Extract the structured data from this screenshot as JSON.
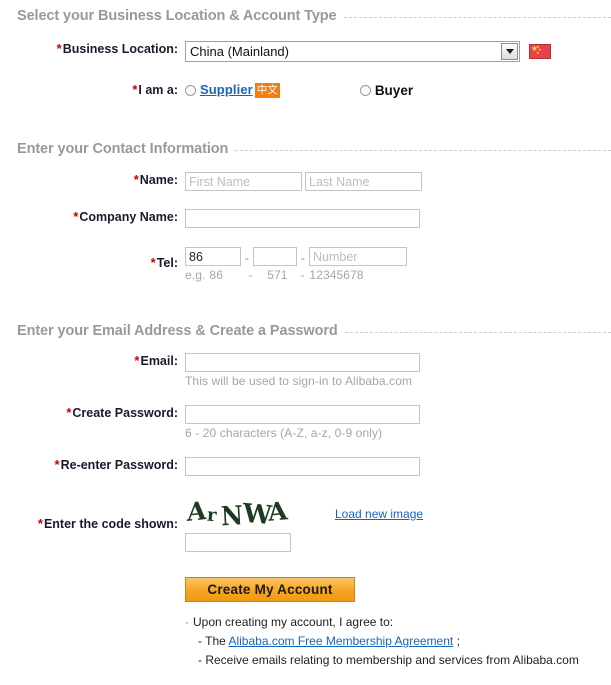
{
  "sections": {
    "location": {
      "title": "Select your Business Location & Account Type"
    },
    "contact": {
      "title": "Enter your Contact Information"
    },
    "account": {
      "title": "Enter your Email Address & Create a Password"
    }
  },
  "required_marker": "*",
  "business_location": {
    "label": "Business Location:",
    "selected": "China (Mainland)",
    "options": [
      "China (Mainland)"
    ],
    "flag_name": "china-flag-icon",
    "flag_color": "#e8424a",
    "star_color": "#ffdd55"
  },
  "role": {
    "label": "I am a:",
    "supplier_label": "Supplier",
    "supplier_badge": "中文",
    "badge_color": "#f57c12",
    "buyer_label": "Buyer",
    "selected": "none"
  },
  "name": {
    "label": "Name:",
    "first_value": "",
    "first_placeholder": "First Name",
    "last_value": "",
    "last_placeholder": "Last Name"
  },
  "company": {
    "label": "Company Name:",
    "value": "",
    "placeholder": ""
  },
  "tel": {
    "label": "Tel:",
    "country_value": "86",
    "area_value": "",
    "number_value": "",
    "number_placeholder": "Number",
    "separator": "-",
    "hint_prefix": "e.g.",
    "hint_country": "86",
    "hint_area": "571",
    "hint_number": "12345678"
  },
  "email": {
    "label": "Email:",
    "value": "",
    "placeholder": "",
    "hint": "This will be used to sign-in to Alibaba.com"
  },
  "password": {
    "label": "Create Password:",
    "value": "",
    "hint": "6 - 20 characters (A-Z, a-z, 0-9 only)"
  },
  "password_confirm": {
    "label": "Re-enter Password:",
    "value": ""
  },
  "captcha": {
    "label": "Enter the code shown:",
    "code_text": "ArNWA",
    "code_chars": [
      "A",
      "r",
      "N",
      "W",
      "A"
    ],
    "code_color": "#1d3b22",
    "reload_link": "Load new image",
    "input_value": "",
    "input_placeholder": ""
  },
  "submit": {
    "label": "Create My Account",
    "accent_color": "#f5a623"
  },
  "terms": {
    "bullet": "·",
    "intro": "Upon creating my account, I agree to:",
    "line2_prefix": "- The",
    "agreement_link": "Alibaba.com Free Membership Agreement",
    "line2_suffix": ";",
    "line3": "- Receive emails relating to membership and services from Alibaba.com"
  }
}
